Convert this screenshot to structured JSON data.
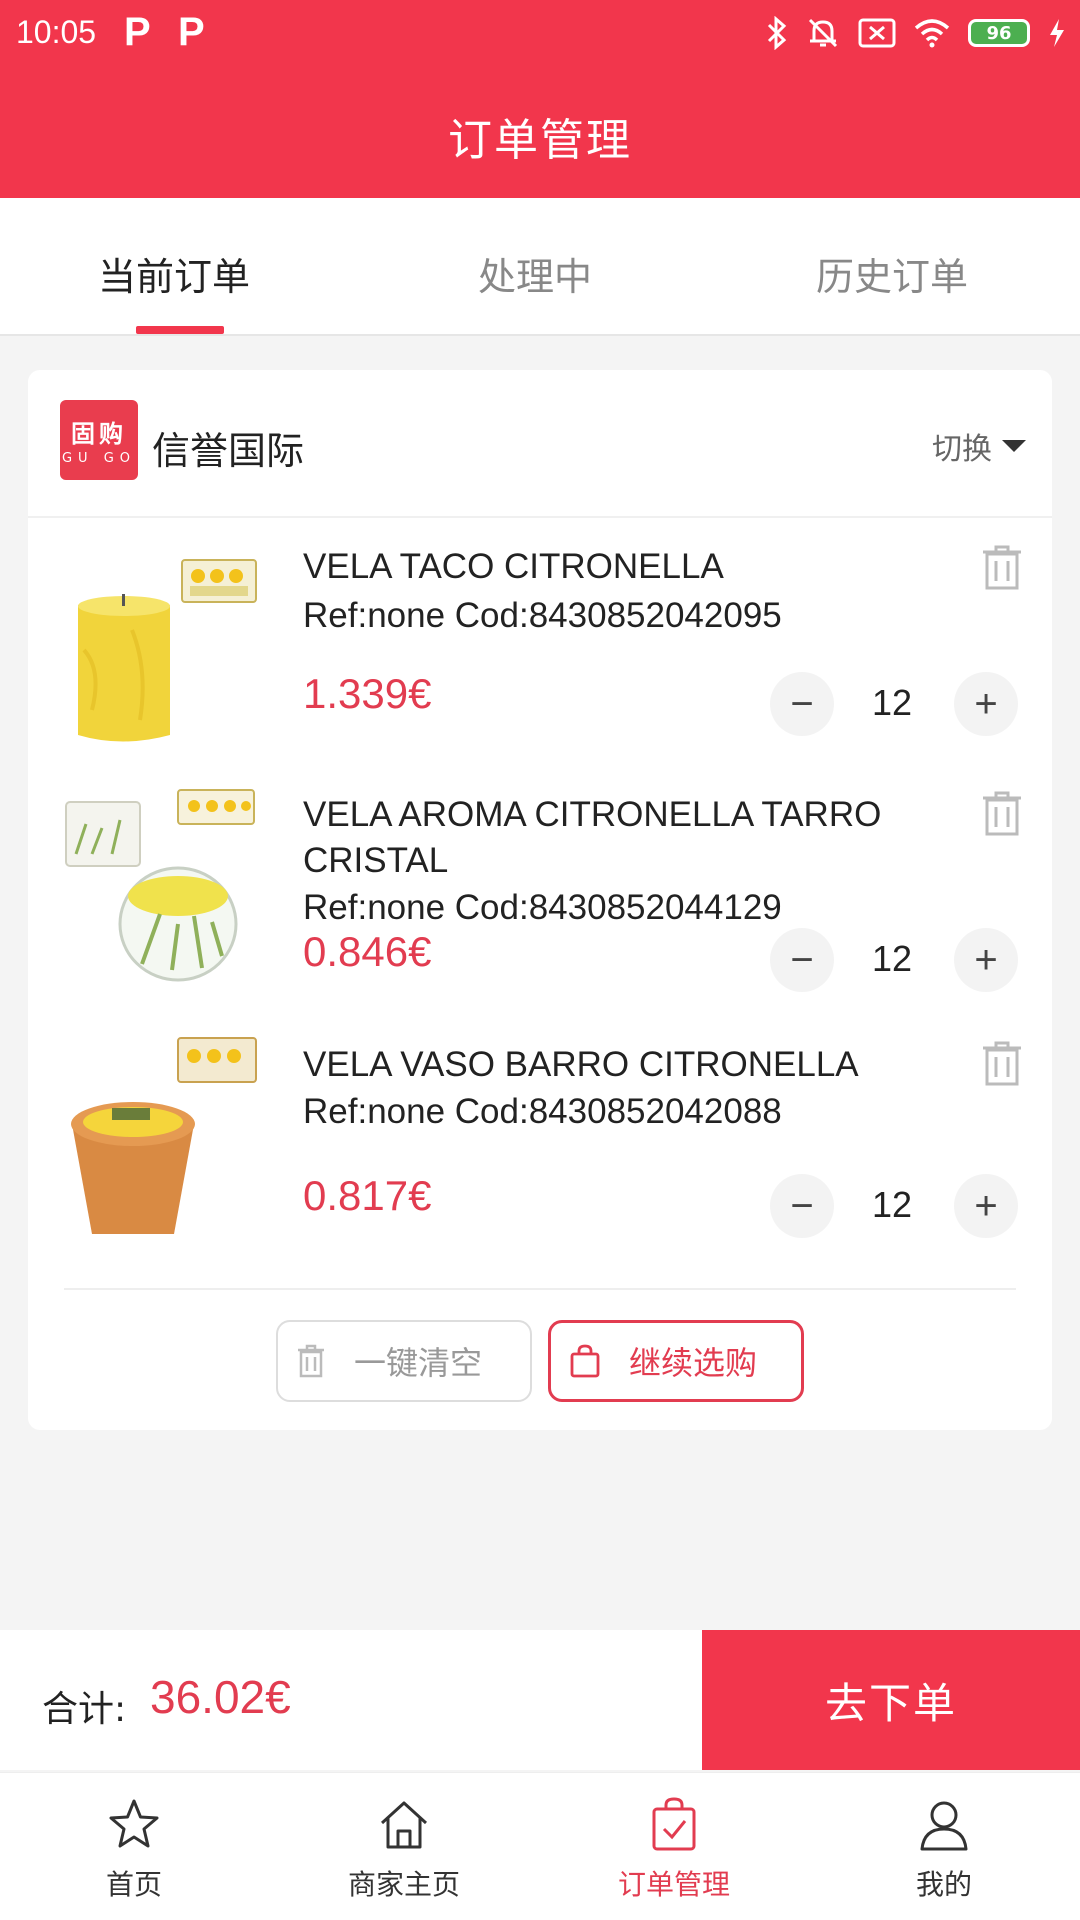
{
  "status_bar": {
    "time": "10:05",
    "p1": "P",
    "p2": "P",
    "battery": "96"
  },
  "header": {
    "title": "订单管理"
  },
  "tabs": [
    {
      "label": "当前订单",
      "active": true
    },
    {
      "label": "处理中",
      "active": false
    },
    {
      "label": "历史订单",
      "active": false
    }
  ],
  "shop": {
    "logo_top": "固购",
    "logo_bottom": "GU GO",
    "name": "信誉国际",
    "switch_label": "切换"
  },
  "items": [
    {
      "name": "VELA TACO CITRONELLA",
      "code": "Ref:none Cod:8430852042095",
      "price": "1.339€",
      "qty": "12"
    },
    {
      "name": "VELA AROMA CITRONELLA TARRO CRISTAL",
      "code": "Ref:none Cod:8430852044129",
      "price": "0.846€",
      "qty": "12"
    },
    {
      "name": "VELA VASO BARRO CITRONELLA",
      "code": "Ref:none Cod:8430852042088",
      "price": "0.817€",
      "qty": "12"
    }
  ],
  "actions": {
    "clear_label": "一键清空",
    "continue_label": "继续选购"
  },
  "footer": {
    "total_label": "合计:",
    "total_value": "36.02€",
    "checkout_label": "去下单"
  },
  "nav": [
    {
      "label": "首页",
      "icon": "star-icon",
      "active": false
    },
    {
      "label": "商家主页",
      "icon": "home-icon",
      "active": false
    },
    {
      "label": "订单管理",
      "icon": "order-bag-icon",
      "active": true
    },
    {
      "label": "我的",
      "icon": "user-icon",
      "active": false
    }
  ],
  "colors": {
    "brand": "#f2364c",
    "price": "#e23c50"
  }
}
